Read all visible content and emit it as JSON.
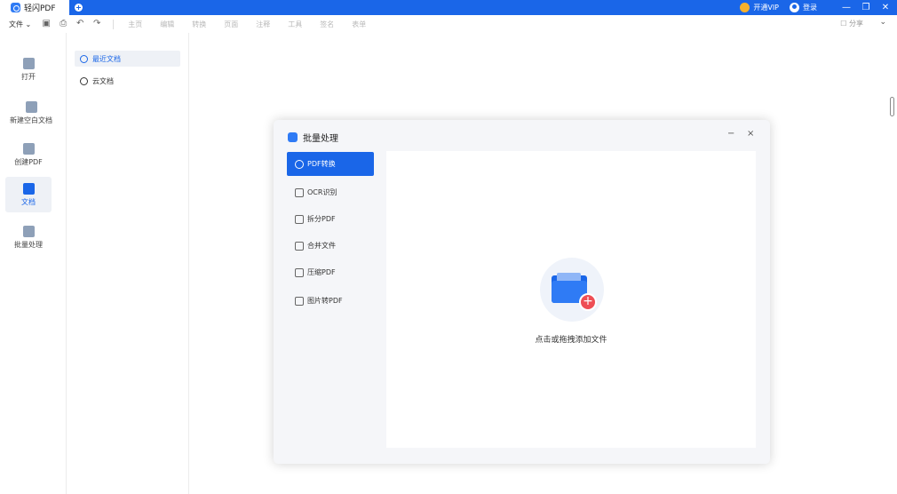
{
  "titlebar": {
    "app_name": "轻闪PDF",
    "vip": "开通VIP",
    "login": "登录",
    "win_min": "—",
    "win_restore": "❐",
    "win_close": "✕"
  },
  "toolbar": {
    "file": "文件 ⌄",
    "icons": {
      "save": "▣",
      "print": "⎙",
      "undo": "↶",
      "redo": "↷"
    },
    "menu": [
      "主页",
      "编辑",
      "转换",
      "页面",
      "注释",
      "工具",
      "签名",
      "表单"
    ],
    "share": "分享",
    "expand": "⌄"
  },
  "leftnav": {
    "items": [
      {
        "label": "打开"
      },
      {
        "label": "新建空白文档"
      },
      {
        "label": "创建PDF"
      },
      {
        "label": "文档"
      },
      {
        "label": "批量处理"
      }
    ]
  },
  "col2": {
    "recent": "最近文档",
    "cloud": "云文档"
  },
  "dialog": {
    "title": "批量处理",
    "min": "−",
    "close": "×",
    "items": [
      "PDF转换",
      "OCR识别",
      "拆分PDF",
      "合并文件",
      "压缩PDF",
      "图片转PDF"
    ],
    "drop_plus": "+",
    "drop_text": "点击或拖拽添加文件"
  },
  "colors": {
    "accent": "#1a66e8",
    "badge": "#ee4e55",
    "vip": "#f7b12b"
  }
}
